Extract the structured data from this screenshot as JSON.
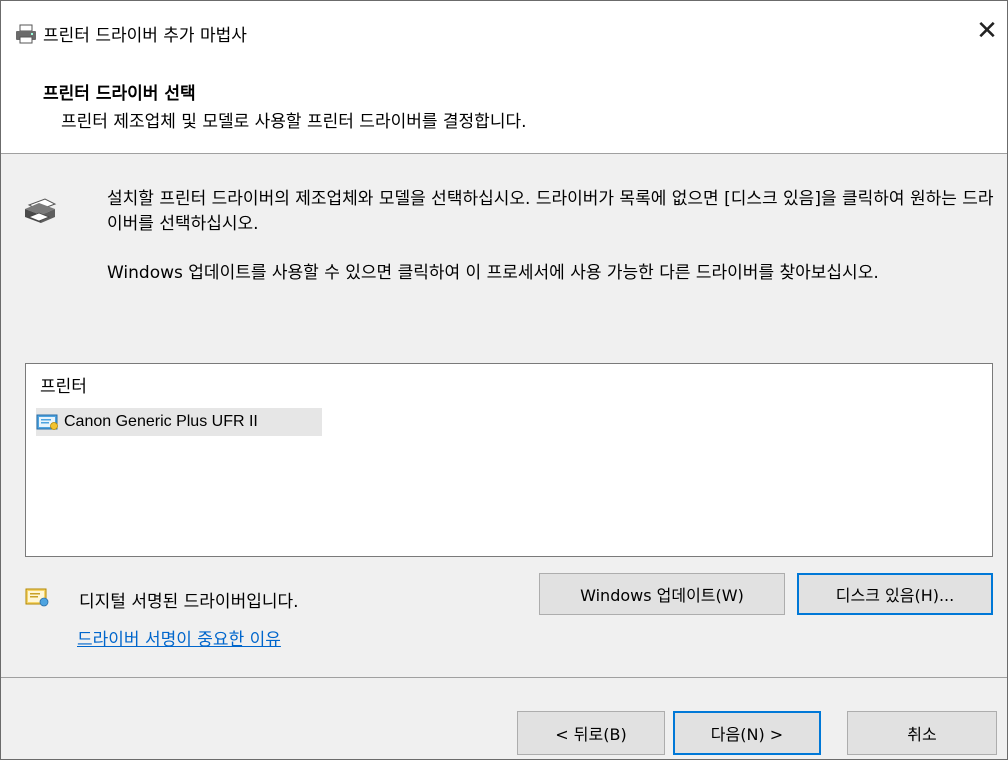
{
  "window": {
    "title": "프린터 드라이버 추가 마법사",
    "close_glyph": "✕"
  },
  "header": {
    "title": "프린터 드라이버 선택",
    "subtitle": "프린터 제조업체 및 모델로 사용할 프린터 드라이버를 결정합니다."
  },
  "description": {
    "line1": "설치할 프린터 드라이버의 제조업체와 모델을 선택하십시오. 드라이버가 목록에 없으면 [디스크 있음]을 클릭하여 원하는 드라이버를 선택하십시오.",
    "line2": "Windows 업데이트를 사용할 수 있으면 클릭하여 이 프로세서에 사용 가능한 다른 드라이버를 찾아보십시오."
  },
  "list": {
    "header": "프린터",
    "items": [
      {
        "label": "Canon Generic Plus UFR II",
        "icon": "certificate-icon",
        "selected": true
      }
    ]
  },
  "signature": {
    "text": "디지털 서명된 드라이버입니다.",
    "link": "드라이버 서명이 중요한 이유"
  },
  "buttons": {
    "windows_update": "Windows 업데이트(W)",
    "have_disk": "디스크 있음(H)...",
    "back": "< 뒤로(B)",
    "next": "다음(N) >",
    "cancel": "취소"
  },
  "colors": {
    "accent": "#0078d7",
    "link": "#0066cc",
    "selection": "#e6e6e6"
  }
}
